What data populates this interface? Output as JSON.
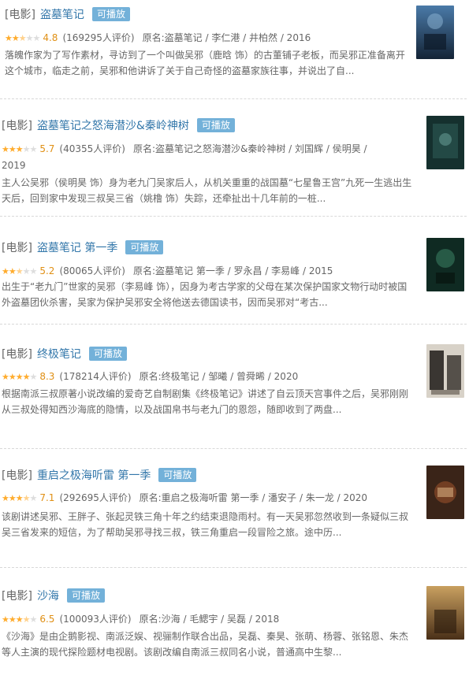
{
  "items": [
    {
      "category": "[电影]",
      "title": "盗墓笔记",
      "badge": "可播放",
      "rating": "4.8",
      "count": "(169295人评价)",
      "sub": "原名:盗墓笔记 / 李仁港 / 井柏然 / 2016",
      "desc": "落魄作家为了写作素材，寻访到了一个叫做吴邪（鹿晗 饰）的古董铺子老板，而吴邪正准备离开这个城市，临走之前，吴邪和他讲诉了关于自己奇怪的盗墓家族往事，并说出了自...",
      "poster_color": "#2b4a6e"
    },
    {
      "category": "[电影]",
      "title": "盗墓笔记之怒海潜沙&秦岭神树",
      "badge": "可播放",
      "rating": "5.7",
      "count": "(40355人评价)",
      "sub": "原名:盗墓笔记之怒海潜沙&秦岭神树 / 刘国辉 / 侯明昊 /",
      "sub2": "2019",
      "desc": "主人公吴邪（侯明昊 饰）身为老九门吴家后人，从机关重重的战国墓“七星鲁王宫”九死一生逃出生天后，回到家中发现三叔吴三省（姚橹 饰）失踪，还牵扯出十几年前的一桩...",
      "poster_color": "#1f3a3a"
    },
    {
      "category": "[电影]",
      "title": "盗墓笔记 第一季",
      "badge": "可播放",
      "rating": "5.2",
      "count": "(80065人评价)",
      "sub": "原名:盗墓笔记 第一季 / 罗永昌 / 李易峰 / 2015",
      "desc": "出生于“老九门”世家的吴邪（李易峰 饰），因身为考古学家的父母在某次保护国家文物行动时被国外盗墓团伙杀害，吴家为保护吴邪安全将他送去德国读书，因而吴邪对“考古...",
      "poster_color": "#1e3b33"
    },
    {
      "category": "[电影]",
      "title": "终极笔记",
      "badge": "可播放",
      "rating": "8.3",
      "count": "(178214人评价)",
      "sub": "原名:终极笔记 / 邹曦 / 曾舜晞 / 2020",
      "desc": "根据南派三叔原著小说改编的爱奇艺自制剧集《终极笔记》讲述了自云顶天宫事件之后，吴邪刚刚从三叔处得知西沙海底的隐情，以及战国帛书与老九门的恩怨，随即收到了两盘...",
      "poster_color": "#4a4540"
    },
    {
      "category": "[电影]",
      "title": "重启之极海听雷 第一季",
      "badge": "可播放",
      "rating": "7.1",
      "count": "(292695人评价)",
      "sub": "原名:重启之极海听雷 第一季 / 潘安子 / 朱一龙 / 2020",
      "desc": "该剧讲述吴邪、王胖子、张起灵铁三角十年之约结束退隐雨村。有一天吴邪忽然收到一条疑似三叔吴三省发来的短信，为了帮助吴邪寻找三叔，铁三角重启一段冒险之旅。途中历...",
      "poster_color": "#5a3a2a"
    },
    {
      "category": "[电影]",
      "title": "沙海",
      "badge": "可播放",
      "rating": "6.5",
      "count": "(100093人评价)",
      "sub": "原名:沙海 / 毛鳃宇 / 吴磊 / 2018",
      "desc": "《沙海》是由企鹅影视、南派泛娱、视骊制作联合出品，吴磊、秦昊、张萌、杨蓉、张铭恩、朱杰等人主演的现代探险题材电视剧。该剧改编自南派三叔同名小说，普通高中生黎...",
      "poster_color": "#7a5a30"
    }
  ]
}
